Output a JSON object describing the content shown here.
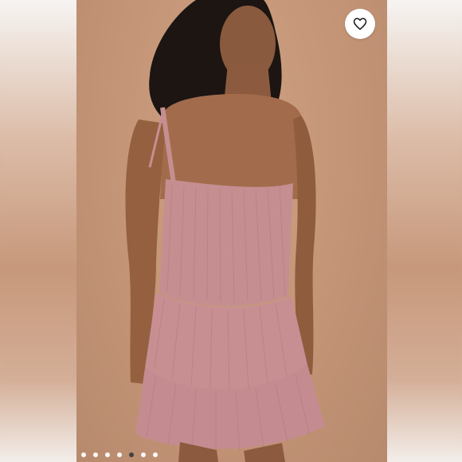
{
  "gallery": {
    "image_count": 7,
    "active_index": 4,
    "active_dot_color": "#3d3d3d",
    "dot_color": "#ffffff"
  },
  "like_button": {
    "icon": "heart-outline-icon",
    "color": "#1a1a1a"
  },
  "photo": {
    "subject": "product-photo",
    "background_color": "#c39476",
    "dress_color": "#c58f91"
  }
}
